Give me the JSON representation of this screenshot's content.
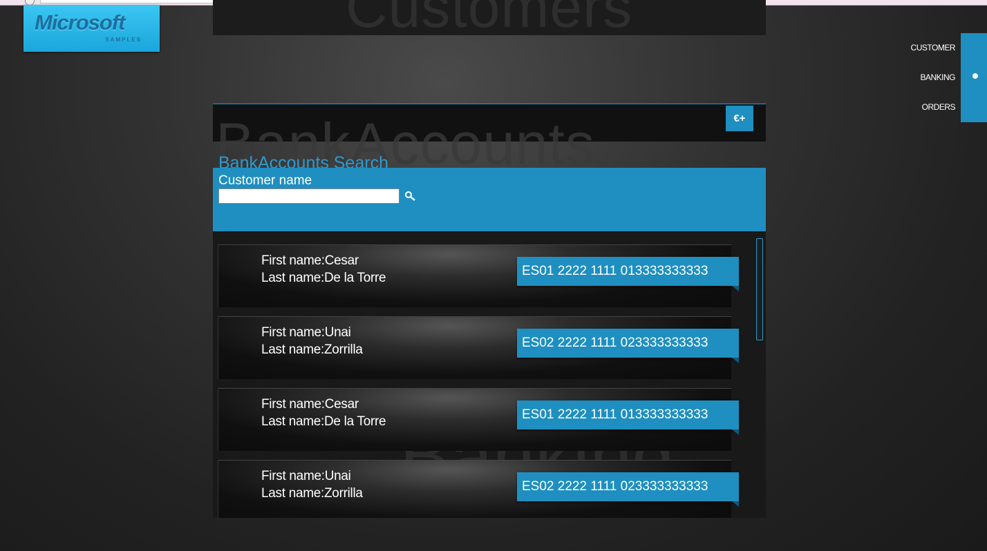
{
  "app": {
    "logo_text": "Microsoft",
    "logo_sub": "SAMPLES",
    "watermark_top": "Customers"
  },
  "nav": {
    "items": [
      "CUSTOMER",
      "BANKING",
      "ORDERS"
    ],
    "active": "BANKING"
  },
  "banking": {
    "watermark": "BankAccounts",
    "add_icon": "€+",
    "search_title": "BankAccounts Search",
    "customer_name_label": "Customer name",
    "customer_name_value": "",
    "list_watermark": "Banking"
  },
  "accounts": [
    {
      "first_label": "First name:",
      "first": "Cesar",
      "last_label": "Last name:",
      "last": "De la Torre",
      "iban": "ES01 2222 1111 013333333333"
    },
    {
      "first_label": "First name:",
      "first": "Unai",
      "last_label": "Last name:",
      "last": "Zorrilla",
      "iban": "ES02 2222 1111 023333333333"
    },
    {
      "first_label": "First name:",
      "first": "Cesar",
      "last_label": "Last name:",
      "last": "De la Torre",
      "iban": "ES01 2222 1111 013333333333"
    },
    {
      "first_label": "First name:",
      "first": "Unai",
      "last_label": "Last name:",
      "last": "Zorrilla",
      "iban": "ES02 2222 1111 023333333333"
    }
  ],
  "colors": {
    "accent": "#1e8fc0",
    "background": "#2a2a2a"
  }
}
